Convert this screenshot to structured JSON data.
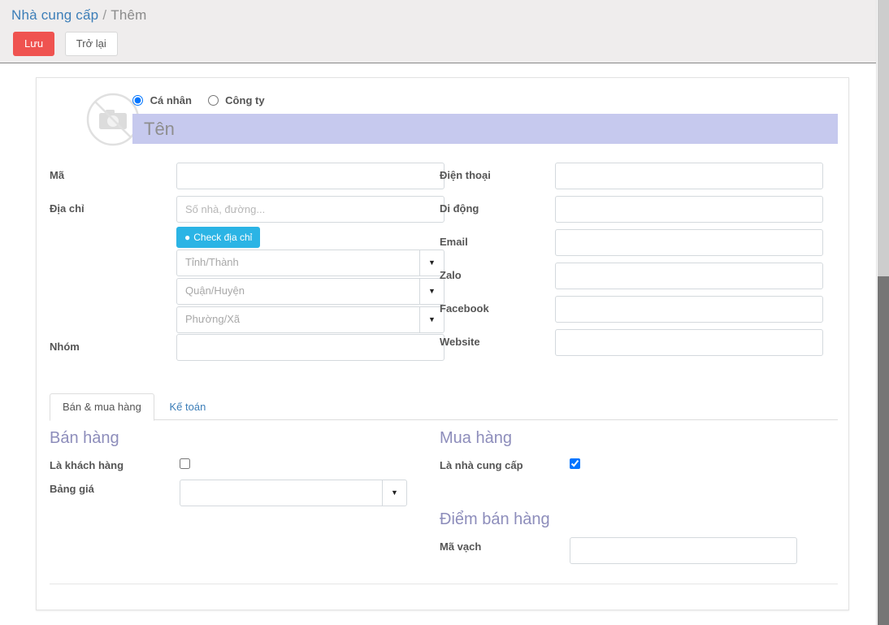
{
  "header": {
    "breadcrumb": {
      "parent": "Nhà cung cấp",
      "separator": "/",
      "current": "Thêm"
    },
    "buttons": {
      "save": "Lưu",
      "back": "Trở lại"
    }
  },
  "avatar": {
    "icon": "no-camera-icon"
  },
  "entity_type": {
    "options": [
      {
        "label": "Cá nhân",
        "selected": true
      },
      {
        "label": "Công ty",
        "selected": false
      }
    ]
  },
  "name_field": {
    "placeholder": "Tên",
    "value": "",
    "background": "#c6c9ee"
  },
  "left_column": {
    "code": {
      "label": "Mã",
      "value": "",
      "placeholder": ""
    },
    "address": {
      "label": "Địa chỉ",
      "street_placeholder": "Số nhà, đường...",
      "street_value": "",
      "check_button": {
        "label": "Check địa chỉ",
        "icon": "map-pin-icon",
        "color": "#2bb4e5"
      },
      "province": {
        "placeholder": "Tỉnh/Thành",
        "value": ""
      },
      "district": {
        "placeholder": "Quận/Huyện",
        "value": ""
      },
      "ward": {
        "placeholder": "Phường/Xã",
        "value": ""
      }
    },
    "group": {
      "label": "Nhóm",
      "value": "",
      "placeholder": ""
    }
  },
  "right_column": {
    "fields": [
      {
        "label": "Điện thoại",
        "value": "",
        "placeholder": ""
      },
      {
        "label": "Di động",
        "value": "",
        "placeholder": ""
      },
      {
        "label": "Email",
        "value": "",
        "placeholder": ""
      },
      {
        "label": "Zalo",
        "value": "",
        "placeholder": ""
      },
      {
        "label": "Facebook",
        "value": "",
        "placeholder": ""
      },
      {
        "label": "Website",
        "value": "",
        "placeholder": ""
      }
    ]
  },
  "tabs": [
    {
      "label": "Bán & mua hàng",
      "active": true
    },
    {
      "label": "Kế toán",
      "active": false
    }
  ],
  "sales_section": {
    "title": "Bán hàng",
    "is_customer": {
      "label": "Là khách hàng",
      "checked": false
    },
    "price_list": {
      "label": "Bảng giá",
      "value": "",
      "placeholder": ""
    }
  },
  "purchase_section": {
    "title": "Mua hàng",
    "is_supplier": {
      "label": "Là nhà cung cấp",
      "checked": true
    }
  },
  "pos_section": {
    "title": "Điểm bán hàng",
    "barcode": {
      "label": "Mã vạch",
      "value": "",
      "placeholder": ""
    }
  },
  "colors": {
    "save_button": "#ef5350",
    "link": "#3c7eb8",
    "section_title": "#8d8dbb",
    "header_bg": "#efeded"
  }
}
